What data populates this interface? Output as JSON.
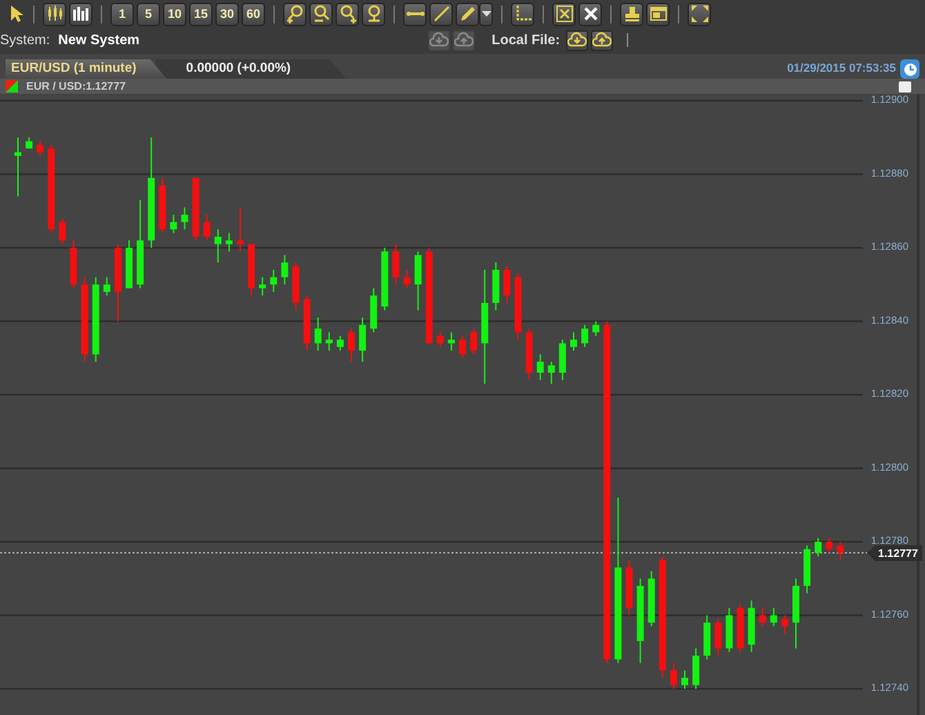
{
  "toolbar": {
    "groups": [
      [
        {
          "kind": "plain"
        }
      ],
      [
        {
          "kind": "icon"
        },
        {
          "kind": "icon"
        }
      ],
      [
        {
          "kind": "text",
          "label": "1"
        },
        {
          "kind": "text",
          "label": "5"
        },
        {
          "kind": "text",
          "label": "10"
        },
        {
          "kind": "text",
          "label": "15"
        },
        {
          "kind": "text",
          "label": "30"
        },
        {
          "kind": "text",
          "label": "60"
        }
      ],
      [
        {
          "kind": "icon"
        },
        {
          "kind": "icon"
        },
        {
          "kind": "icon"
        },
        {
          "kind": "icon"
        }
      ],
      [
        {
          "kind": "icon"
        },
        {
          "kind": "icon"
        },
        {
          "kind": "icon"
        },
        {
          "kind": "dropdown"
        }
      ],
      [
        {
          "kind": "icon"
        }
      ],
      [
        {
          "kind": "icon"
        },
        {
          "kind": "icon"
        }
      ],
      [
        {
          "kind": "icon"
        },
        {
          "kind": "icon"
        }
      ],
      [
        {
          "kind": "icon"
        }
      ]
    ]
  },
  "system_bar": {
    "label": "System:",
    "value": "New System",
    "cloud_buttons": [
      {
        "disabled": true
      },
      {
        "disabled": true
      }
    ],
    "local_file": {
      "label": "Local File:",
      "buttons": [
        {
          "disabled": false
        },
        {
          "disabled": false
        }
      ]
    }
  },
  "tabs": [
    {
      "label": "EUR/USD (1 minute)",
      "selected": true
    },
    {
      "label": "0.00000 (+0.00%)",
      "selected": false
    }
  ],
  "timestamp": "01/29/2015 07:53:35",
  "chart": {
    "symbol": "EUR / USD:1.12777",
    "current_price": "1.12777",
    "chart_data": {
      "type": "candlestick",
      "grid": true,
      "ylim": [
        1.1274,
        1.129
      ],
      "ref_lines": [
        {
          "axis": "y",
          "value": 1.12777
        }
      ],
      "yticks": [
        {
          "value": 1.129,
          "label": "1.12900"
        },
        {
          "value": 1.1288,
          "label": "1.12880"
        },
        {
          "value": 1.1286,
          "label": "1.12860"
        },
        {
          "value": 1.1284,
          "label": "1.12840"
        },
        {
          "value": 1.1282,
          "label": "1.12820"
        },
        {
          "value": 1.128,
          "label": "1.12800"
        },
        {
          "value": 1.1278,
          "label": "1.12780"
        },
        {
          "value": 1.1276,
          "label": "1.12760"
        },
        {
          "value": 1.1274,
          "label": "1.12740"
        }
      ],
      "ohlc": [
        [
          1.12885,
          1.1289,
          1.12874,
          1.12886
        ],
        [
          1.12887,
          1.1289,
          1.12887,
          1.12889
        ],
        [
          1.12888,
          1.12889,
          1.12885,
          1.12886
        ],
        [
          1.12887,
          1.12888,
          1.12864,
          1.12865
        ],
        [
          1.12867,
          1.12868,
          1.12861,
          1.12862
        ],
        [
          1.1286,
          1.12862,
          1.12849,
          1.1285
        ],
        [
          1.1285,
          1.12852,
          1.12829,
          1.12831
        ],
        [
          1.12831,
          1.12852,
          1.12829,
          1.1285
        ],
        [
          1.12848,
          1.12852,
          1.12847,
          1.1285
        ],
        [
          1.1286,
          1.12861,
          1.1284,
          1.12848
        ],
        [
          1.12849,
          1.12862,
          1.12849,
          1.1286
        ],
        [
          1.1285,
          1.12873,
          1.12849,
          1.12862
        ],
        [
          1.12862,
          1.1289,
          1.1286,
          1.12879
        ],
        [
          1.12877,
          1.12879,
          1.12864,
          1.12865
        ],
        [
          1.12865,
          1.12869,
          1.12864,
          1.12867
        ],
        [
          1.12867,
          1.12871,
          1.12865,
          1.12869
        ],
        [
          1.12879,
          1.12879,
          1.12862,
          1.12863
        ],
        [
          1.12867,
          1.12869,
          1.12862,
          1.12863
        ],
        [
          1.12861,
          1.12865,
          1.12856,
          1.12863
        ],
        [
          1.12861,
          1.12864,
          1.12859,
          1.12862
        ],
        [
          1.12862,
          1.12871,
          1.12859,
          1.12861
        ],
        [
          1.12861,
          1.12861,
          1.12847,
          1.12849
        ],
        [
          1.12849,
          1.12852,
          1.12847,
          1.1285
        ],
        [
          1.1285,
          1.12854,
          1.12848,
          1.12852
        ],
        [
          1.12852,
          1.12858,
          1.1285,
          1.12856
        ],
        [
          1.12855,
          1.12856,
          1.12843,
          1.12845
        ],
        [
          1.12846,
          1.12847,
          1.12832,
          1.12834
        ],
        [
          1.12834,
          1.12841,
          1.12832,
          1.12838
        ],
        [
          1.12834,
          1.12837,
          1.12832,
          1.12835
        ],
        [
          1.12833,
          1.12836,
          1.12832,
          1.12835
        ],
        [
          1.12837,
          1.12838,
          1.12829,
          1.12832
        ],
        [
          1.12832,
          1.12841,
          1.12829,
          1.12839
        ],
        [
          1.12838,
          1.12849,
          1.12837,
          1.12847
        ],
        [
          1.12844,
          1.1286,
          1.12843,
          1.12859
        ],
        [
          1.12859,
          1.12861,
          1.1285,
          1.12852
        ],
        [
          1.12852,
          1.12854,
          1.12849,
          1.1285
        ],
        [
          1.1285,
          1.12859,
          1.12843,
          1.12858
        ],
        [
          1.12859,
          1.1286,
          1.12834,
          1.12834
        ],
        [
          1.12836,
          1.12837,
          1.12833,
          1.12834
        ],
        [
          1.12834,
          1.12837,
          1.12832,
          1.12835
        ],
        [
          1.12835,
          1.12836,
          1.1283,
          1.12831
        ],
        [
          1.12837,
          1.12838,
          1.12831,
          1.12832
        ],
        [
          1.12834,
          1.12854,
          1.12823,
          1.12845
        ],
        [
          1.12845,
          1.12856,
          1.12843,
          1.12854
        ],
        [
          1.12854,
          1.12855,
          1.12845,
          1.12847
        ],
        [
          1.12852,
          1.12853,
          1.12835,
          1.12837
        ],
        [
          1.12837,
          1.12838,
          1.12824,
          1.12826
        ],
        [
          1.12826,
          1.12831,
          1.12824,
          1.12829
        ],
        [
          1.12826,
          1.12829,
          1.12823,
          1.12828
        ],
        [
          1.12826,
          1.12835,
          1.12824,
          1.12834
        ],
        [
          1.12833,
          1.12837,
          1.12832,
          1.12835
        ],
        [
          1.12834,
          1.12839,
          1.12833,
          1.12838
        ],
        [
          1.12837,
          1.1284,
          1.12836,
          1.12839
        ],
        [
          1.12839,
          1.1284,
          1.12747,
          1.12748
        ],
        [
          1.12748,
          1.12792,
          1.12747,
          1.12773
        ],
        [
          1.12773,
          1.12775,
          1.1276,
          1.12762
        ],
        [
          1.12753,
          1.1277,
          1.12747,
          1.12768
        ],
        [
          1.12758,
          1.12772,
          1.12757,
          1.1277
        ],
        [
          1.12775,
          1.12776,
          1.12743,
          1.12745
        ],
        [
          1.12745,
          1.12747,
          1.1274,
          1.12741
        ],
        [
          1.12741,
          1.12745,
          1.1274,
          1.12743
        ],
        [
          1.12741,
          1.12751,
          1.1274,
          1.12749
        ],
        [
          1.12749,
          1.1276,
          1.12748,
          1.12758
        ],
        [
          1.12758,
          1.12759,
          1.12749,
          1.12751
        ],
        [
          1.12751,
          1.12762,
          1.1275,
          1.1276
        ],
        [
          1.12762,
          1.12763,
          1.1275,
          1.12751
        ],
        [
          1.12752,
          1.12764,
          1.1275,
          1.12762
        ],
        [
          1.1276,
          1.12762,
          1.12757,
          1.12758
        ],
        [
          1.12758,
          1.12762,
          1.12757,
          1.1276
        ],
        [
          1.12759,
          1.1276,
          1.12755,
          1.12757
        ],
        [
          1.12758,
          1.1277,
          1.12751,
          1.12768
        ],
        [
          1.12768,
          1.12779,
          1.12766,
          1.12778
        ],
        [
          1.12777,
          1.12781,
          1.12776,
          1.1278
        ],
        [
          1.1278,
          1.12781,
          1.12777,
          1.12778
        ],
        [
          1.12779,
          1.1278,
          1.12775,
          1.12777
        ]
      ]
    }
  }
}
